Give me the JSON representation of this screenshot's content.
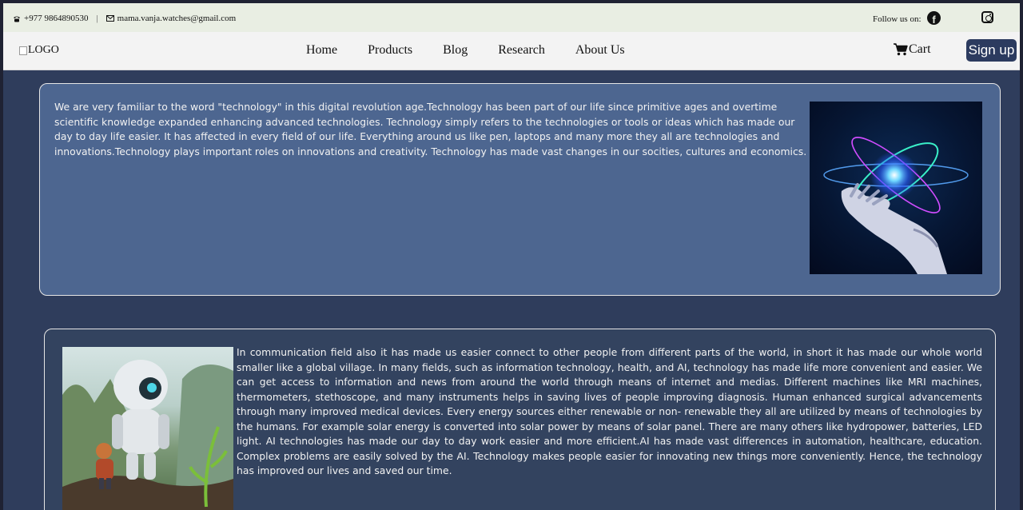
{
  "topbar": {
    "phone": "+977 9864890530",
    "separator": "|",
    "email": "mama.vanja.watches@gmail.com",
    "follow_label": "Follow us on:",
    "social": [
      "facebook-icon",
      "instagram-icon"
    ]
  },
  "navbar": {
    "logo_alt": "LOGO",
    "links": [
      "Home",
      "Products",
      "Blog",
      "Research",
      "About Us"
    ],
    "cart_label": "Cart",
    "signup_label": "Sign up"
  },
  "cards": [
    {
      "text": "We are very familiar to the word \"technology\" in this digital revolution age.Technology has been part of our life since primitive ages and overtime scientific knowledge expanded enhancing advanced technologies. Technology simply refers to the technologies or tools or ideas which has made our day to day life easier. It has affected in every field of our life. Everything around us like pen, laptops and many more they all are technologies and innovations.Technology plays important roles on innovations and creativity. Technology has made vast changes in our socities, cultures and economics.",
      "image": "robot-hand-atom-image"
    },
    {
      "text": "In communication field also it has made us easier connect to other people from different parts of the world, in short it has made our whole world smaller like a global village. In many fields, such as information technology, health, and AI, technology has made life more convenient and easier. We can get access to information and news from around the world through means of internet and medias. Different machines like MRI machines, thermometers, stethoscope, and many instruments helps in saving lives of people improving diagnosis. Human enhanced surgical advancements through many improved medical devices. Every energy sources either renewable or non- renewable they all are utilized by means of technologies by the humans. For example solar energy is converted into solar power by means of solar panel. There are many others like hydropower, batteries, LED light. AI technologies has made our day to day work easier and more efficient.AI has made vast differences in automation, healthcare, education. Complex problems are easily solved by the AI. Technology makes people easier for innovating new things more conveniently. Hence, the technology has improved our lives and saved our time.",
      "image": "robot-and-child-image"
    }
  ],
  "colors": {
    "page_bg": "#2f3d5c",
    "topbar_bg": "#e9eee3",
    "navbar_bg": "#f3f3f3",
    "card1_bg": "#4d6690",
    "card2_bg": "#33435f",
    "signup_bg": "#2c3b5f"
  }
}
